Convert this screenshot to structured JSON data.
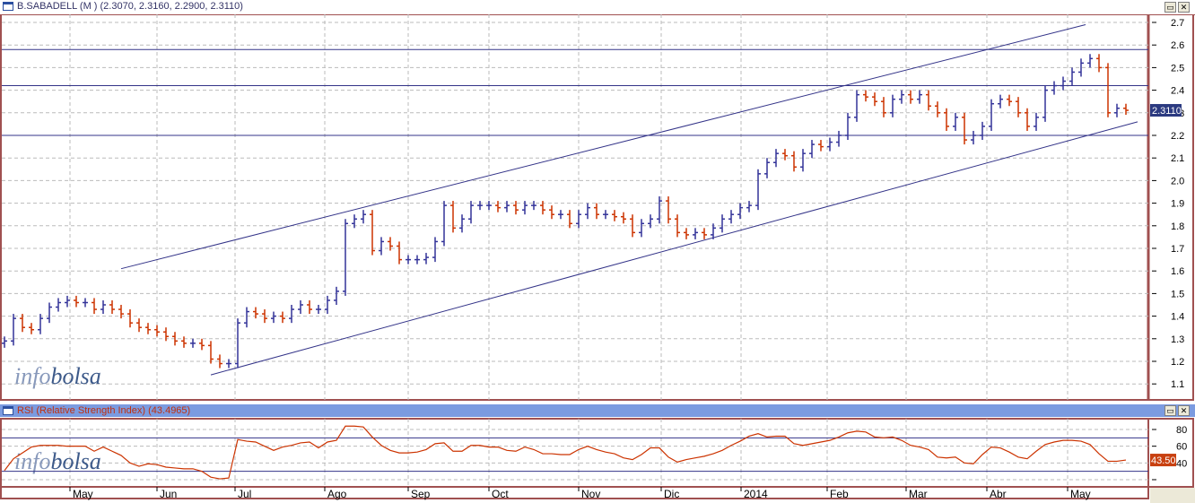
{
  "window": {
    "title": "B.SABADELL (M ) (2.3070, 2.3160, 2.2900, 2.3110)",
    "maximize_icon": "maximize-icon",
    "close_icon": "close-icon"
  },
  "rsi_panel": {
    "title": "RSI (Relative Strength Index) (43.4965)"
  },
  "watermark": {
    "part1": "info",
    "part2": "bolsa"
  },
  "colors": {
    "up": "#333399",
    "down": "#cc3300",
    "rsi_line": "#cc3300",
    "line": "#333388",
    "rsi_header": "#7b9be0",
    "border": "#a05050"
  },
  "chart_data": [
    {
      "type": "ohlc",
      "title": "B.SABADELL (M ) (2.3070, 2.3160, 2.2900, 2.3110)",
      "ylim": [
        1.05,
        2.75
      ],
      "y_ticks": [
        "2.7",
        "2.6",
        "2.5",
        "2.4",
        "2.3",
        "2.2",
        "2.1",
        "2.0",
        "1.9",
        "1.8",
        "1.7",
        "1.6",
        "1.5",
        "1.4",
        "1.3",
        "1.2",
        "1.1"
      ],
      "last_value_label": "2.3110",
      "x_month_labels": [
        "May",
        "Jun",
        "Jul",
        "Ago",
        "Sep",
        "Oct",
        "Nov",
        "Dic",
        "2014",
        "Feb",
        "Mar",
        "Abr",
        "May"
      ],
      "grid": true,
      "close": [
        1.29,
        1.39,
        1.35,
        1.34,
        1.39,
        1.44,
        1.46,
        1.47,
        1.46,
        1.46,
        1.43,
        1.45,
        1.43,
        1.41,
        1.37,
        1.35,
        1.34,
        1.33,
        1.31,
        1.29,
        1.28,
        1.28,
        1.27,
        1.21,
        1.19,
        1.19,
        1.37,
        1.42,
        1.41,
        1.39,
        1.4,
        1.39,
        1.43,
        1.45,
        1.43,
        1.43,
        1.47,
        1.51,
        1.81,
        1.83,
        1.85,
        1.69,
        1.73,
        1.71,
        1.65,
        1.65,
        1.65,
        1.66,
        1.73,
        1.89,
        1.79,
        1.83,
        1.89,
        1.89,
        1.89,
        1.88,
        1.89,
        1.87,
        1.89,
        1.89,
        1.87,
        1.85,
        1.85,
        1.81,
        1.85,
        1.88,
        1.85,
        1.85,
        1.84,
        1.83,
        1.77,
        1.81,
        1.83,
        1.91,
        1.83,
        1.77,
        1.76,
        1.77,
        1.76,
        1.79,
        1.83,
        1.85,
        1.88,
        1.89,
        2.03,
        2.08,
        2.12,
        2.11,
        2.06,
        2.12,
        2.16,
        2.15,
        2.17,
        2.2,
        2.28,
        2.38,
        2.37,
        2.35,
        2.3,
        2.36,
        2.38,
        2.36,
        2.38,
        2.33,
        2.3,
        2.24,
        2.28,
        2.18,
        2.2,
        2.24,
        2.34,
        2.36,
        2.35,
        2.3,
        2.24,
        2.28,
        2.4,
        2.42,
        2.44,
        2.48,
        2.52,
        2.54,
        2.5,
        2.3,
        2.32,
        2.311
      ],
      "horizontal_lines": [
        2.58,
        2.42,
        2.2
      ],
      "trend_lines": [
        {
          "from": [
            13,
            1.61
          ],
          "to": [
            120.5,
            2.69
          ]
        },
        {
          "from": [
            23,
            1.14
          ],
          "to": [
            126.3,
            2.26
          ]
        }
      ]
    },
    {
      "type": "line",
      "title": "RSI (Relative Strength Index) (43.4965)",
      "ylim": [
        8,
        92
      ],
      "y_ticks": [
        "80",
        "60",
        "40"
      ],
      "last_value_label": "43.50",
      "horizontal_lines": [
        70,
        30
      ],
      "values": [
        31,
        45,
        52,
        59,
        61,
        61,
        61,
        60,
        60,
        60,
        54,
        59,
        54,
        49,
        40,
        36,
        39,
        38,
        35,
        34,
        33,
        33,
        30,
        23,
        21,
        22,
        68,
        66,
        65,
        60,
        55,
        59,
        61,
        64,
        65,
        58,
        65,
        67,
        84,
        84,
        83,
        71,
        61,
        55,
        52,
        52,
        53,
        56,
        63,
        64,
        54,
        54,
        61,
        61,
        59,
        59,
        55,
        54,
        59,
        56,
        51,
        51,
        50,
        50,
        56,
        60,
        56,
        53,
        51,
        46,
        44,
        50,
        58,
        58,
        47,
        41,
        44,
        46,
        48,
        51,
        55,
        61,
        66,
        72,
        75,
        71,
        72,
        72,
        63,
        61,
        63,
        65,
        67,
        71,
        76,
        78,
        77,
        71,
        70,
        71,
        67,
        61,
        59,
        56,
        47,
        46,
        47,
        40,
        39,
        50,
        59,
        58,
        53,
        47,
        45,
        54,
        62,
        65,
        67,
        67,
        66,
        62,
        51,
        42,
        42,
        43.5
      ]
    }
  ]
}
